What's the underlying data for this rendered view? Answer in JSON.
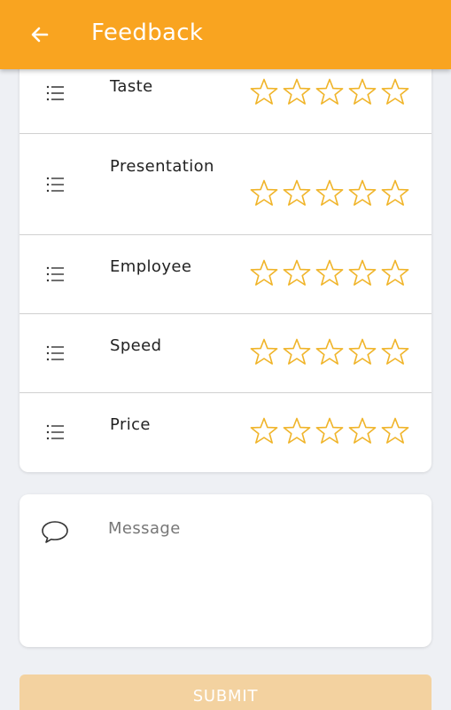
{
  "appbar": {
    "title": "Feedback",
    "back_icon": "arrow-left-icon",
    "color": "#f9a420"
  },
  "ratings": [
    {
      "label": "Taste",
      "rating": 0,
      "max": 5
    },
    {
      "label": "Presentation",
      "rating": 0,
      "max": 5
    },
    {
      "label": "Employee",
      "rating": 0,
      "max": 5
    },
    {
      "label": "Speed",
      "rating": 0,
      "max": 5
    },
    {
      "label": "Price",
      "rating": 0,
      "max": 5
    }
  ],
  "row_icon": "list-icon",
  "star_icon": "star-outline-icon",
  "star_color": "#f0b429",
  "message": {
    "icon": "speech-bubble-icon",
    "placeholder": "Message",
    "value": ""
  },
  "submit": {
    "label": "SUBMIT",
    "color": "#f3d2a0"
  }
}
